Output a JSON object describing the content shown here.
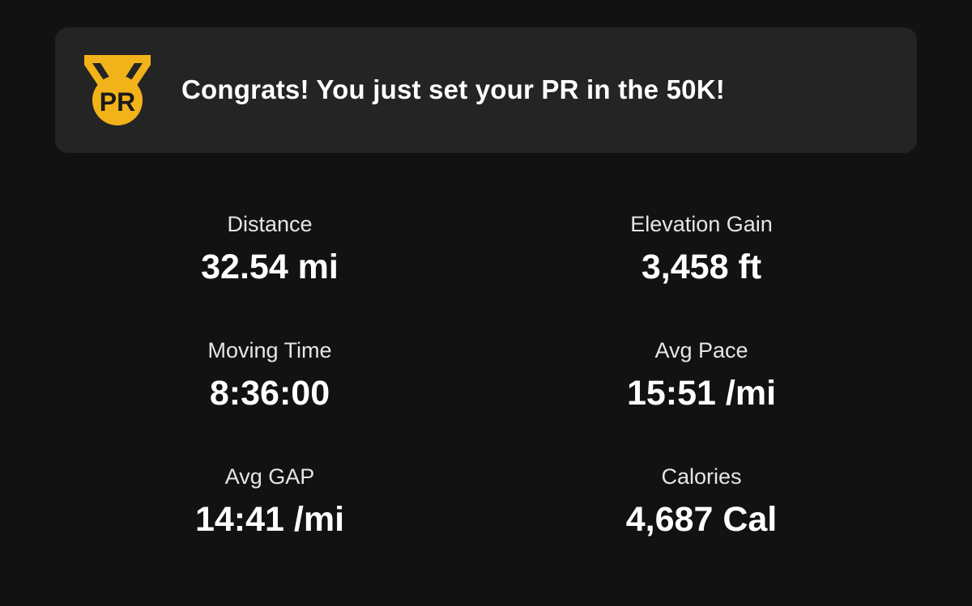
{
  "banner": {
    "message": "Congrats! You just set your PR in the 50K!",
    "medal_icon": "pr-medal-icon",
    "medal_text": "PR",
    "medal_color": "#F2B21A"
  },
  "stats": [
    {
      "label": "Distance",
      "value": "32.54 mi"
    },
    {
      "label": "Elevation Gain",
      "value": "3,458 ft"
    },
    {
      "label": "Moving Time",
      "value": "8:36:00"
    },
    {
      "label": "Avg Pace",
      "value": "15:51 /mi"
    },
    {
      "label": "Avg GAP",
      "value": "14:41 /mi"
    },
    {
      "label": "Calories",
      "value": "4,687 Cal"
    }
  ],
  "colors": {
    "background": "#121212",
    "banner_background": "#242424",
    "text": "#FFFFFF",
    "accent": "#F2B21A"
  }
}
